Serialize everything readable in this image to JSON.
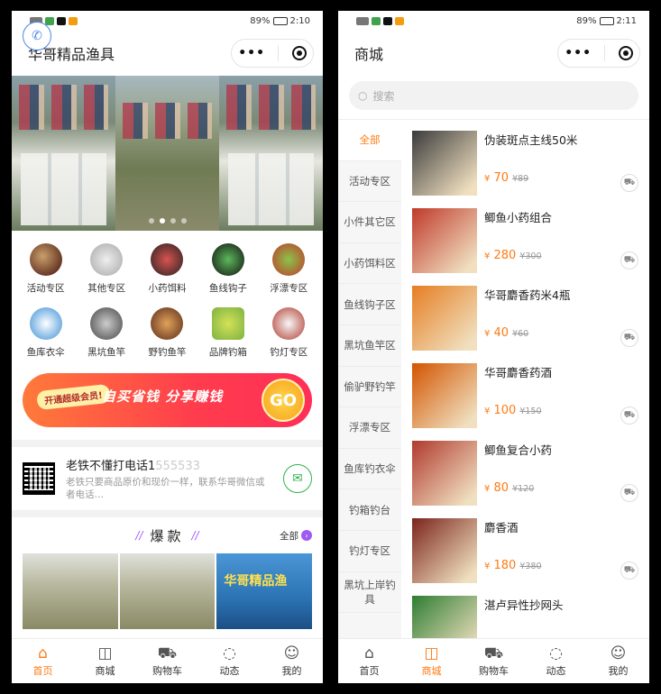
{
  "home": {
    "status": {
      "time": "2:10",
      "battery": "89%"
    },
    "title": "华哥精品渔具",
    "categories": [
      "活动专区",
      "其他专区",
      "小药饵料",
      "鱼线钩子",
      "浮漂专区",
      "鱼库衣伞",
      "黑坑鱼竿",
      "野钓鱼竿",
      "品牌钓箱",
      "钓灯专区"
    ],
    "promo": {
      "badge": "开通超级会员!",
      "slogan": "自买省钱 分享赚钱",
      "go": "GO"
    },
    "contact": {
      "title": "老铁不懂打电话1",
      "masked": "555533",
      "sub": "老铁只要商品原价和现价一样，联系华哥微信或者电话…"
    },
    "hot": {
      "title": "爆款",
      "all": "全部",
      "bottle_text": "华哥精品渔"
    }
  },
  "shop": {
    "status": {
      "time": "2:11",
      "battery": "89%"
    },
    "title": "商城",
    "search_placeholder": "搜索",
    "sidebar": [
      "全部",
      "活动专区",
      "小件其它区",
      "小药饵料区",
      "鱼线钩子区",
      "黑坑鱼竿区",
      "偷驴野钓竿",
      "浮漂专区",
      "鱼库钓衣伞",
      "钓箱钓台",
      "钓灯专区",
      "黑坑上岸钓具"
    ],
    "products": [
      {
        "name": "伪装斑点主线50米",
        "price": "70",
        "old": "¥89",
        "img_color": "#3b3b3b"
      },
      {
        "name": "鲫鱼小药组合",
        "price": "280",
        "old": "¥300",
        "img_color": "#c0392b"
      },
      {
        "name": "华哥麝香药米4瓶",
        "price": "40",
        "old": "¥60",
        "img_color": "#e67e22"
      },
      {
        "name": "华哥麝香药酒",
        "price": "100",
        "old": "¥150",
        "img_color": "#d35400"
      },
      {
        "name": "鲫鱼复合小药",
        "price": "80",
        "old": "¥120",
        "img_color": "#b03a2e"
      },
      {
        "name": "麝香酒",
        "price": "180",
        "old": "¥380",
        "img_color": "#7b241c"
      },
      {
        "name": "湛卢异性抄网头",
        "price": "",
        "old": "",
        "img_color": "#2e7d32"
      }
    ]
  },
  "tabs": [
    "首页",
    "商城",
    "购物车",
    "动态",
    "我的"
  ],
  "currency": "¥"
}
